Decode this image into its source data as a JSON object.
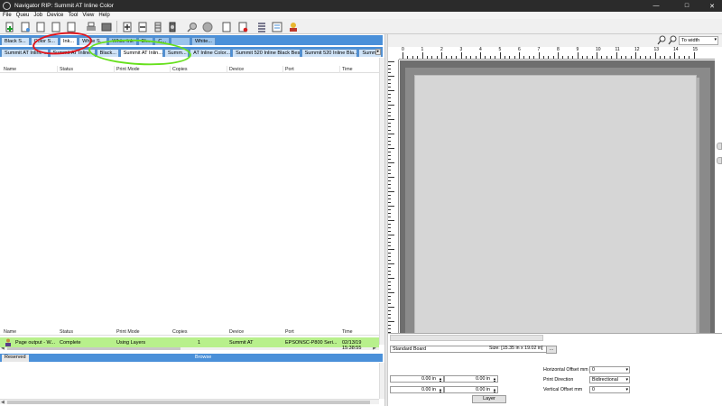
{
  "window": {
    "title": "Navigator RIP: Summit AT Inline Color"
  },
  "menu": [
    "File",
    "Queu",
    "Job",
    "Device",
    "Tool",
    "View",
    "Help"
  ],
  "toolbar": {
    "icons": [
      "new-job-icon",
      "document-icon",
      "document-icon",
      "document-icon",
      "print-icon",
      "media-icon",
      "move-up-icon",
      "move-down-icon",
      "stack-icon",
      "settings-icon",
      "zoom-icon",
      "stop-icon",
      "document-icon",
      "remove-icon",
      "list-icon",
      "queue-icon",
      "user-icon"
    ]
  },
  "ink_tabs": [
    "Black S...",
    "Color S...",
    "Ink...",
    "White S...",
    "White Ink",
    "Bl...",
    "C...",
    "",
    "White..."
  ],
  "device_tabs": [
    "Summit AT Inline ...",
    "Summit AT Inline...",
    "Black...",
    "Summit AT Inlin...",
    "Summ...",
    "AT Inline Color...",
    "Summit 520 Inline Black Best",
    "Summit 520 Inline Bla...",
    "Summit"
  ],
  "queue_columns": [
    "Name",
    "Status",
    "Print Mode",
    "Copies",
    "Device",
    "Port",
    "Time"
  ],
  "browse_tabs": {
    "left": "Reserved",
    "right": "Browse"
  },
  "job_columns": [
    "Name",
    "Status",
    "Print Mode",
    "Copies",
    "Device",
    "Port",
    "Time"
  ],
  "jobs": [
    {
      "name": "Page output - W...",
      "status": "Complete",
      "print_mode": "Using Layers",
      "copies": "1",
      "device": "Summit AT",
      "port": "EPSONSC-P800 Seri...",
      "time": "02/13/19 15:38:55"
    }
  ],
  "preview": {
    "zoom_value": "To width",
    "ruler_labels": [
      "0",
      "1",
      "2",
      "3",
      "4",
      "5",
      "6",
      "7",
      "8",
      "9",
      "10",
      "11",
      "12",
      "13",
      "14",
      "15"
    ]
  },
  "settings": {
    "board": "Standard Board",
    "size": "Size: [15.35 in x 19.02 in]",
    "size_button": "...",
    "offsets": [
      "0.00 in",
      "0.00 in",
      "0.00 in",
      "0.00 in"
    ],
    "layer_button": "Layer",
    "horizontal_offset_label": "Horizontal Offset mm",
    "horizontal_offset_value": "0",
    "print_direction_label": "Print Direction",
    "print_direction_value": "Bidirectional",
    "vertical_offset_label": "Vertical Offset mm",
    "vertical_offset_value": "0"
  },
  "colors": {
    "accent": "#4a90d9",
    "selected_row": "#b8f08c",
    "annotation_red": "#e0141c",
    "annotation_green": "#66e01c"
  }
}
